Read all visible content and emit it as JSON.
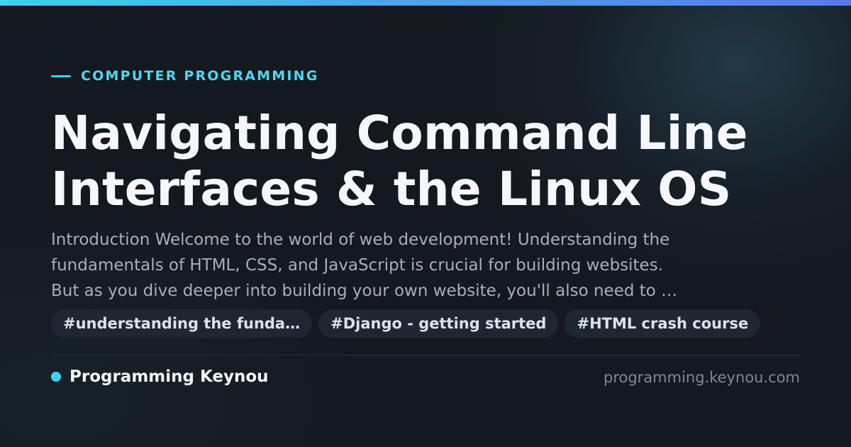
{
  "category": {
    "label": "COMPUTER PROGRAMMING",
    "accent_color": "#3fd2ee"
  },
  "title": "Navigating Command Line\nInterfaces & the Linux OS",
  "excerpt": "Introduction Welcome to the world of web development! Understanding the\nfundamentals of HTML, CSS, and JavaScript is crucial for building websites.\nBut as you dive deeper into building your own website, you'll also need to …",
  "tags": [
    "#understanding the funda…",
    "#Django - getting started",
    "#HTML crash course"
  ],
  "footer": {
    "brand_name": "Programming Keynou",
    "domain": "programming.keynou.com"
  },
  "colors": {
    "background": "#13171e",
    "accent": "#3fd2ee",
    "title_text": "#f5f7fa",
    "muted_text": "#a6afbb"
  }
}
